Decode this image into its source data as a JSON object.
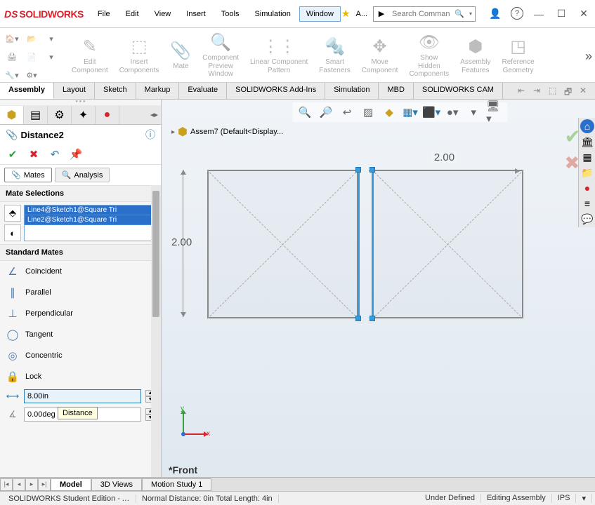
{
  "app": {
    "logo_prefix": "DS",
    "logo_name": "SOLIDWORKS"
  },
  "menu": {
    "items": [
      "File",
      "Edit",
      "View",
      "Insert",
      "Tools",
      "Simulation",
      "Window"
    ],
    "active": "Window"
  },
  "title_right": {
    "after_menu": "A...",
    "search_placeholder": "Search Comman"
  },
  "ribbon": {
    "groups": [
      {
        "label": "Edit\nComponent"
      },
      {
        "label": "Insert\nComponents"
      },
      {
        "label": "Mate"
      },
      {
        "label": "Component\nPreview\nWindow"
      },
      {
        "label": "Linear Component\nPattern"
      },
      {
        "label": "Smart\nFasteners"
      },
      {
        "label": "Move\nComponent"
      },
      {
        "label": "Show\nHidden\nComponents"
      },
      {
        "label": "Assembly\nFeatures"
      },
      {
        "label": "Reference\nGeometry"
      }
    ]
  },
  "cmd_tabs": [
    "Assembly",
    "Layout",
    "Sketch",
    "Markup",
    "Evaluate",
    "SOLIDWORKS Add-Ins",
    "Simulation",
    "MBD",
    "SOLIDWORKS CAM"
  ],
  "cmd_tab_active": "Assembly",
  "property": {
    "title": "Distance2",
    "sub_tabs": {
      "mates": "Mates",
      "analysis": "Analysis"
    },
    "sections": {
      "selections": "Mate Selections",
      "standard": "Standard Mates"
    },
    "selected_items": [
      "Line4@Sketch1@Square Tri",
      "Line2@Sketch1@Square Tri"
    ],
    "mates": [
      {
        "name": "coincident",
        "label": "Coincident",
        "glyph": "∠"
      },
      {
        "name": "parallel",
        "label": "Parallel",
        "glyph": "∥"
      },
      {
        "name": "perpendicular",
        "label": "Perpendicular",
        "glyph": "⊥"
      },
      {
        "name": "tangent",
        "label": "Tangent",
        "glyph": "◯"
      },
      {
        "name": "concentric",
        "label": "Concentric",
        "glyph": "◎"
      },
      {
        "name": "lock",
        "label": "Lock",
        "glyph": "🔒"
      }
    ],
    "tooltip": "Distance",
    "distance_value": "8.00in",
    "angle_value": "0.00deg"
  },
  "canvas": {
    "breadcrumb": "Assem7  (Default<Display...",
    "dim_h": "2.00",
    "dim_v": "2.00",
    "view_label": "*Front",
    "triad": {
      "x": "x",
      "y": "y"
    }
  },
  "bottom_tabs": [
    "Model",
    "3D Views",
    "Motion Study 1"
  ],
  "bottom_tab_active": "Model",
  "status": {
    "left1": "SOLIDWORKS Student Edition - A...",
    "left2": "Normal Distance: 0in Total Length: 4in",
    "mid1": "Under Defined",
    "mid2": "Editing Assembly",
    "units": "IPS"
  }
}
